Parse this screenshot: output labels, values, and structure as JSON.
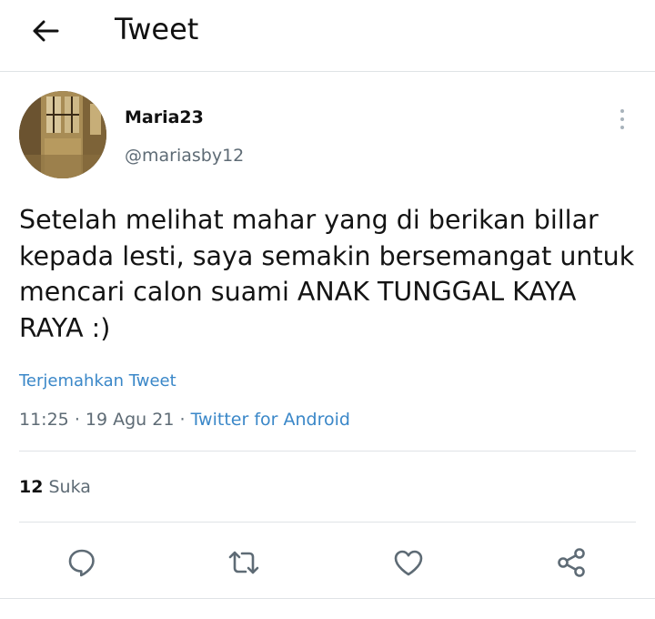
{
  "header": {
    "back_icon": "arrow-left-icon",
    "title": "Tweet"
  },
  "tweet": {
    "author": {
      "name": "Maria23",
      "handle": "@mariasby12",
      "avatar_icon": "profile-photo-avatar"
    },
    "more_icon": "vertical-dots-icon",
    "text": "Setelah melihat mahar yang di berikan billar kepada lesti, saya semakin bersemangat untuk mencari calon suami ANAK TUNGGAL KAYA RAYA :)",
    "translate_label": "Terjemahkan Tweet",
    "time": "11:25",
    "date": "19 Agu 21",
    "separator": "·",
    "source": "Twitter for Android",
    "likes": {
      "count": "12",
      "label": "Suka"
    }
  },
  "actions": [
    {
      "name": "reply",
      "icon": "comment-icon"
    },
    {
      "name": "retweet",
      "icon": "retweet-icon"
    },
    {
      "name": "like",
      "icon": "heart-icon"
    },
    {
      "name": "share",
      "icon": "share-icon"
    }
  ],
  "colors": {
    "link": "#3a87c8",
    "secondary_text": "#5e6b75",
    "divider": "#dfe3e6",
    "icon": "#5e6b75"
  }
}
